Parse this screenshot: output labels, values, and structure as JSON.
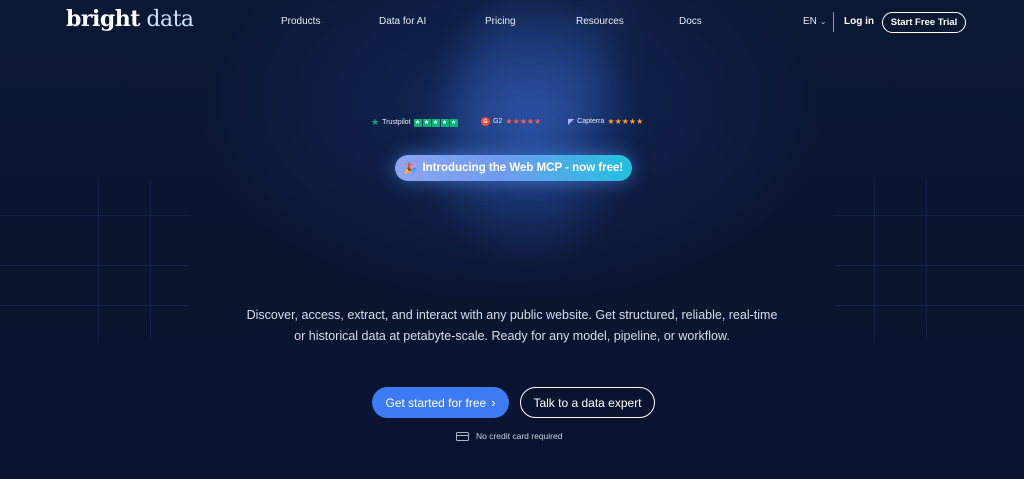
{
  "brand": {
    "name_main": "bright",
    "name_accent": " data"
  },
  "nav": {
    "links": [
      "Products",
      "Data for AI",
      "Pricing",
      "Resources",
      "Docs"
    ],
    "language": "EN",
    "login": "Log in",
    "cta": "Start Free Trial"
  },
  "ratings": {
    "trustpilot": "Trustpilot",
    "g2": "G2",
    "capterra": "Capterra"
  },
  "announcement": {
    "text": "Introducing the Web MCP - now free!"
  },
  "hero": {
    "description_line1": "Discover, access, extract, and interact with any public website. Get structured, reliable, real-time",
    "description_line2": "or historical data at petabyte-scale. Ready for any model, pipeline, or workflow."
  },
  "cta": {
    "primary": "Get started for free",
    "secondary": "Talk to a data expert",
    "note": "No credit card required"
  },
  "colors": {
    "background": "#0a1631",
    "primary_button": "#3d7bf5",
    "trustpilot_green": "#00b67a",
    "g2_red": "#ff492c",
    "capterra_orange": "#ff9d28"
  }
}
